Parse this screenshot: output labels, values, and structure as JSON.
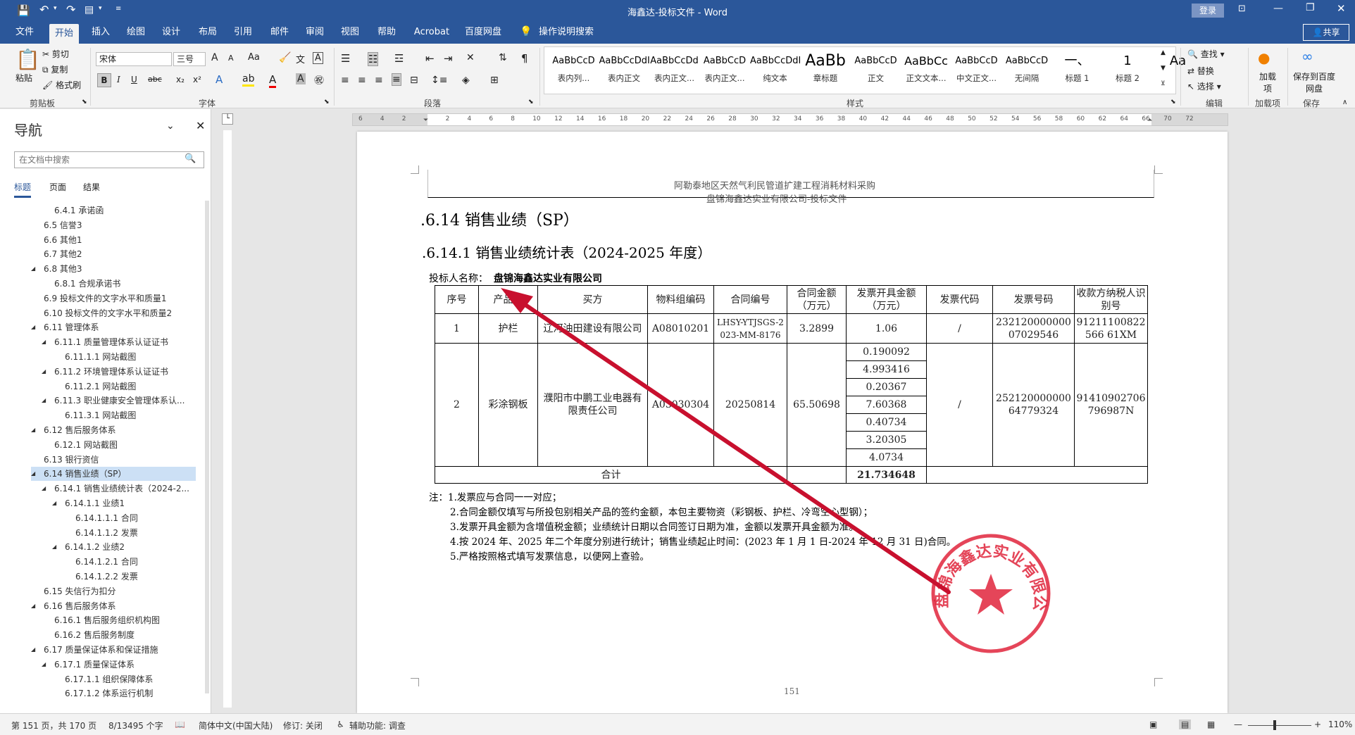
{
  "window": {
    "title": "海鑫达-投标文件 - Word",
    "login": "登录",
    "share": "共享"
  },
  "qat": {
    "save": "保存",
    "undo": "撤销",
    "redo": "重复"
  },
  "tabs": [
    "文件",
    "开始",
    "插入",
    "绘图",
    "设计",
    "布局",
    "引用",
    "邮件",
    "审阅",
    "视图",
    "帮助",
    "Acrobat",
    "百度网盘"
  ],
  "tell_me": "操作说明搜索",
  "ribbon": {
    "clipboard": {
      "paste": "粘贴",
      "cut": "剪切",
      "copy": "复制",
      "format_painter": "格式刷",
      "label": "剪贴板"
    },
    "font": {
      "name": "宋体",
      "size": "三号",
      "label": "字体",
      "bold": "B",
      "italic": "I",
      "underline": "U",
      "strike": "abc",
      "sub": "x₂",
      "sup": "x²",
      "grow": "A",
      "shrink": "A",
      "case": "Aa"
    },
    "paragraph": {
      "label": "段落"
    },
    "styles": {
      "label": "样式",
      "items": [
        {
          "preview": "AaBbCcD",
          "name": "表内列..."
        },
        {
          "preview": "AaBbCcDdI",
          "name": "表内正文"
        },
        {
          "preview": "AaBbCcDd",
          "name": "表内正文..."
        },
        {
          "preview": "AaBbCcD",
          "name": "表内正文..."
        },
        {
          "preview": "AaBbCcDdI",
          "name": "纯文本"
        },
        {
          "preview": "AaBb",
          "name": "章标题"
        },
        {
          "preview": "AaBbCcD",
          "name": "正文"
        },
        {
          "preview": "AaBbCc",
          "name": "正文文本..."
        },
        {
          "preview": "AaBbCcD",
          "name": "中文正文..."
        },
        {
          "preview": "AaBbCcD",
          "name": "无间隔"
        },
        {
          "preview": "一、",
          "name": "标题 1"
        },
        {
          "preview": "1",
          "name": "标题 2"
        },
        {
          "preview": "Aa",
          "name": ""
        }
      ]
    },
    "editing": {
      "find": "查找",
      "replace": "替换",
      "select": "选择",
      "label": "编辑"
    },
    "addins": {
      "btn": "加载项",
      "label": "加载项"
    },
    "save": {
      "btn": "保存到百度网盘",
      "label": "保存"
    }
  },
  "nav": {
    "title": "导航",
    "search_placeholder": "在文档中搜索",
    "tabs": [
      "标题",
      "页面",
      "结果"
    ],
    "items": [
      {
        "text": "6.4.1 承诺函",
        "level": 3,
        "arrow": ""
      },
      {
        "text": "6.5 信誉3",
        "level": 2,
        "arrow": ""
      },
      {
        "text": "6.6 其他1",
        "level": 2,
        "arrow": ""
      },
      {
        "text": "6.7 其他2",
        "level": 2,
        "arrow": ""
      },
      {
        "text": "6.8 其他3",
        "level": 2,
        "arrow": "◢"
      },
      {
        "text": "6.8.1 合规承诺书",
        "level": 3,
        "arrow": ""
      },
      {
        "text": "6.9 投标文件的文字水平和质量1",
        "level": 2,
        "arrow": ""
      },
      {
        "text": "6.10 投标文件的文字水平和质量2",
        "level": 2,
        "arrow": ""
      },
      {
        "text": "6.11 管理体系",
        "level": 2,
        "arrow": "◢"
      },
      {
        "text": "6.11.1 质量管理体系认证证书",
        "level": 3,
        "arrow": "◢"
      },
      {
        "text": "6.11.1.1 网站截图",
        "level": 4,
        "arrow": ""
      },
      {
        "text": "6.11.2 环境管理体系认证证书",
        "level": 3,
        "arrow": "◢"
      },
      {
        "text": "6.11.2.1 网站截图",
        "level": 4,
        "arrow": ""
      },
      {
        "text": "6.11.3 职业健康安全管理体系认...",
        "level": 3,
        "arrow": "◢"
      },
      {
        "text": "6.11.3.1 网站截图",
        "level": 4,
        "arrow": ""
      },
      {
        "text": "6.12 售后服务体系",
        "level": 2,
        "arrow": "◢"
      },
      {
        "text": "6.12.1 网站截图",
        "level": 3,
        "arrow": ""
      },
      {
        "text": "6.13 银行资信",
        "level": 2,
        "arrow": ""
      },
      {
        "text": "6.14 销售业绩（SP）",
        "level": 2,
        "arrow": "◢",
        "selected": true
      },
      {
        "text": "6.14.1 销售业绩统计表（2024-2...",
        "level": 3,
        "arrow": "◢"
      },
      {
        "text": "6.14.1.1 业绩1",
        "level": 4,
        "arrow": "◢"
      },
      {
        "text": "6.14.1.1.1 合同",
        "level": 5,
        "arrow": ""
      },
      {
        "text": "6.14.1.1.2 发票",
        "level": 5,
        "arrow": ""
      },
      {
        "text": "6.14.1.2 业绩2",
        "level": 4,
        "arrow": "◢"
      },
      {
        "text": "6.14.1.2.1 合同",
        "level": 5,
        "arrow": ""
      },
      {
        "text": "6.14.1.2.2 发票",
        "level": 5,
        "arrow": ""
      },
      {
        "text": "6.15 失信行为扣分",
        "level": 2,
        "arrow": ""
      },
      {
        "text": "6.16 售后服务体系",
        "level": 2,
        "arrow": "◢"
      },
      {
        "text": "6.16.1 售后服务组织机构图",
        "level": 3,
        "arrow": ""
      },
      {
        "text": "6.16.2 售后服务制度",
        "level": 3,
        "arrow": ""
      },
      {
        "text": "6.17  质量保证体系和保证措施",
        "level": 2,
        "arrow": "◢"
      },
      {
        "text": "6.17.1 质量保证体系",
        "level": 3,
        "arrow": "◢"
      },
      {
        "text": "6.17.1.1 组织保障体系",
        "level": 4,
        "arrow": ""
      },
      {
        "text": "6.17.1.2 体系运行机制",
        "level": 4,
        "arrow": ""
      }
    ]
  },
  "hruler": [
    "6",
    "4",
    "2",
    "",
    "2",
    "4",
    "6",
    "8",
    "10",
    "12",
    "14",
    "16",
    "18",
    "20",
    "22",
    "24",
    "26",
    "28",
    "30",
    "32",
    "34",
    "36",
    "38",
    "40",
    "42",
    "44",
    "46",
    "48",
    "50",
    "52",
    "54",
    "56",
    "58",
    "60",
    "62",
    "64",
    "66",
    "70",
    "72"
  ],
  "document": {
    "header_line1": "阿勒泰地区天然气利民管道扩建工程消耗材料采购",
    "header_line2": "盘锦海鑫达实业有限公司-投标文件",
    "heading1": ".6.14  销售业绩（SP）",
    "heading2": ".6.14.1   销售业绩统计表（2024-2025 年度）",
    "bidder_label": "投标人名称：",
    "bidder_name": "盘锦海鑫达实业有限公司",
    "table": {
      "headers": [
        "序号",
        "产品名",
        "买方",
        "物料组编码",
        "合同编号",
        "合同金额（万元）",
        "发票开具金额（万元）",
        "发票代码",
        "发票号码",
        "收款方纳税人识别号"
      ],
      "row1": [
        "1",
        "护栏",
        "辽河油田建设有限公司",
        "A08010201",
        "LHSY-YTJSGS-2023-MM-8176",
        "3.2899",
        "1.06",
        "/",
        "23212000000007029546",
        "91211100822566 61XM"
      ],
      "row2": {
        "no": "2",
        "product": "彩涂钢板",
        "buyer": "濮阳市中鹏工业电器有限责任公司",
        "code": "A03030304",
        "contract": "20250814",
        "amount": "65.50698",
        "invoices": [
          "0.190092",
          "4.993416",
          "0.20367",
          "7.60368",
          "0.40734",
          "3.20305",
          "4.0734"
        ],
        "invoice_code": "/",
        "invoice_no": "25212000000064779324",
        "taxid": "91410902706796987N"
      },
      "total_label": "合计",
      "total": "21.734648"
    },
    "notes": [
      "注：1.发票应与合同一一对应；",
      "2.合同金额仅填写与所投包别相关产品的签约金额，本包主要物资（彩钢板、护栏、冷弯空心型钢）；",
      "3.发票开具金额为含增值税金额；业绩统计日期以合同签订日期为准，金额以发票开具金额为准。",
      "4.按 2024 年、2025 年二个年度分别进行统计；销售业绩起止时间：(2023 年 1 月 1 日-2024 年 12 月 31 日)合同。",
      "5.严格按照格式填写发票信息，以便网上查验。"
    ],
    "page_number": "151",
    "stamp_text": "盘锦海鑫达实业有限公司"
  },
  "status": {
    "page": "第 151 页，共 170 页",
    "words": "8/13495 个字",
    "lang": "简体中文(中国大陆)",
    "track": "修订: 关闭",
    "access": "辅助功能: 调查",
    "zoom": "110%"
  },
  "colors": {
    "brand": "#2b579a",
    "stamp": "#e0253c",
    "arrow": "#c8102e"
  }
}
